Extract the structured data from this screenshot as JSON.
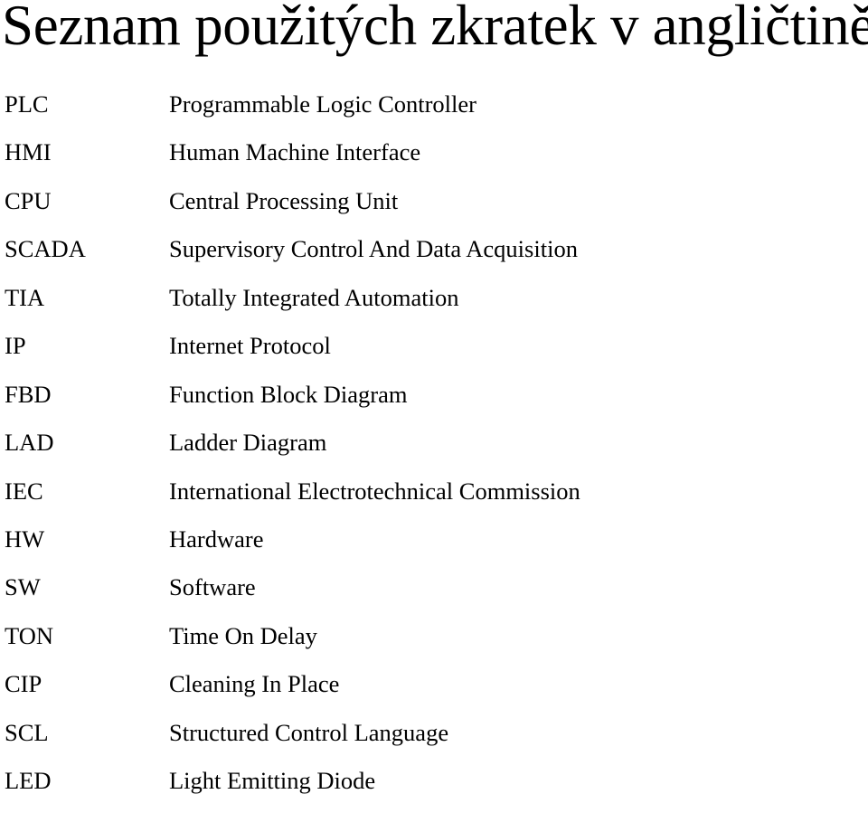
{
  "title": "Seznam použitých zkratek v angličtině",
  "abbreviations": [
    {
      "code": "PLC",
      "meaning": "Programmable Logic Controller"
    },
    {
      "code": "HMI",
      "meaning": "Human Machine Interface"
    },
    {
      "code": "CPU",
      "meaning": "Central Processing Unit"
    },
    {
      "code": "SCADA",
      "meaning": "Supervisory Control And Data Acquisition"
    },
    {
      "code": "TIA",
      "meaning": "Totally Integrated Automation"
    },
    {
      "code": "IP",
      "meaning": "Internet Protocol"
    },
    {
      "code": "FBD",
      "meaning": "Function Block Diagram"
    },
    {
      "code": "LAD",
      "meaning": "Ladder Diagram"
    },
    {
      "code": "IEC",
      "meaning": "International Electrotechnical Commission"
    },
    {
      "code": "HW",
      "meaning": "Hardware"
    },
    {
      "code": "SW",
      "meaning": "Software"
    },
    {
      "code": "TON",
      "meaning": "Time On Delay"
    },
    {
      "code": "CIP",
      "meaning": "Cleaning In Place"
    },
    {
      "code": "SCL",
      "meaning": "Structured Control Language"
    },
    {
      "code": "LED",
      "meaning": "Light Emitting Diode"
    }
  ]
}
